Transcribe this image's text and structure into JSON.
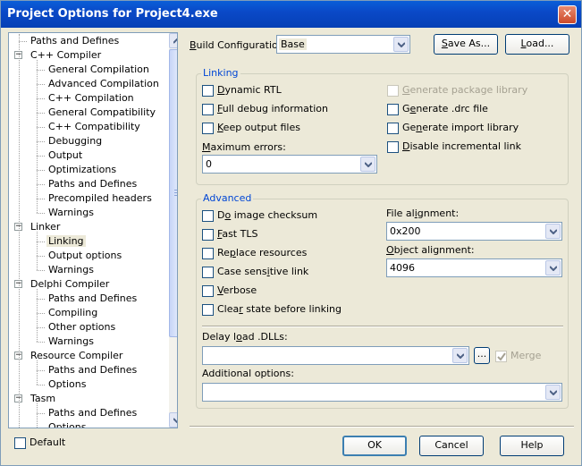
{
  "window": {
    "title": "Project Options for Project4.exe"
  },
  "tree": {
    "items": [
      {
        "label": "Paths and Defines",
        "level": 1,
        "expander": ""
      },
      {
        "label": "C++ Compiler",
        "level": 0,
        "expander": "−"
      },
      {
        "label": "General Compilation",
        "level": 2,
        "expander": ""
      },
      {
        "label": "Advanced Compilation",
        "level": 2,
        "expander": ""
      },
      {
        "label": "C++ Compilation",
        "level": 2,
        "expander": ""
      },
      {
        "label": "General Compatibility",
        "level": 2,
        "expander": ""
      },
      {
        "label": "C++ Compatibility",
        "level": 2,
        "expander": ""
      },
      {
        "label": "Debugging",
        "level": 2,
        "expander": ""
      },
      {
        "label": "Output",
        "level": 2,
        "expander": ""
      },
      {
        "label": "Optimizations",
        "level": 2,
        "expander": ""
      },
      {
        "label": "Paths and Defines",
        "level": 2,
        "expander": ""
      },
      {
        "label": "Precompiled headers",
        "level": 2,
        "expander": ""
      },
      {
        "label": "Warnings",
        "level": 2,
        "expander": ""
      },
      {
        "label": "Linker",
        "level": 0,
        "expander": "−"
      },
      {
        "label": "Linking",
        "level": 2,
        "expander": "",
        "selected": true
      },
      {
        "label": "Output options",
        "level": 2,
        "expander": ""
      },
      {
        "label": "Warnings",
        "level": 2,
        "expander": ""
      },
      {
        "label": "Delphi Compiler",
        "level": 0,
        "expander": "−"
      },
      {
        "label": "Paths and Defines",
        "level": 2,
        "expander": ""
      },
      {
        "label": "Compiling",
        "level": 2,
        "expander": ""
      },
      {
        "label": "Other options",
        "level": 2,
        "expander": ""
      },
      {
        "label": "Warnings",
        "level": 2,
        "expander": ""
      },
      {
        "label": "Resource Compiler",
        "level": 0,
        "expander": "−"
      },
      {
        "label": "Paths and Defines",
        "level": 2,
        "expander": ""
      },
      {
        "label": "Options",
        "level": 2,
        "expander": ""
      },
      {
        "label": "Tasm",
        "level": 0,
        "expander": "−"
      },
      {
        "label": "Paths and Defines",
        "level": 2,
        "expander": ""
      },
      {
        "label": "Options",
        "level": 2,
        "expander": ""
      }
    ]
  },
  "default_checkbox": {
    "label": "Default",
    "checked": false
  },
  "build": {
    "label": "Build Configuration:",
    "value": "Base",
    "save_as": "Save As...",
    "load": "Load..."
  },
  "linking": {
    "legend": "Linking",
    "dynamic_rtl": "Dynamic RTL",
    "full_debug": "Full debug information",
    "keep_output": "Keep output files",
    "max_errors_label": "Maximum errors:",
    "max_errors_value": "0",
    "gen_pkg_lib": "Generate package library",
    "gen_drc": "Generate .drc file",
    "gen_import": "Generate import library",
    "disable_incremental": "Disable incremental link"
  },
  "advanced": {
    "legend": "Advanced",
    "image_checksum": "Do image checksum",
    "fast_tls": "Fast TLS",
    "replace_resources": "Replace resources",
    "case_sensitive": "Case sensitive link",
    "verbose": "Verbose",
    "clear_state": "Clear state before linking",
    "file_alignment_label": "File alignment:",
    "file_alignment_value": "0x200",
    "object_alignment_label": "Object alignment:",
    "object_alignment_value": "4096",
    "delay_load_label": "Delay load .DLLs:",
    "delay_load_value": "",
    "browse": "...",
    "merge": "Merge",
    "merge_checked": true,
    "additional_label": "Additional options:",
    "additional_value": ""
  },
  "buttons": {
    "ok": "OK",
    "cancel": "Cancel",
    "help": "Help"
  }
}
